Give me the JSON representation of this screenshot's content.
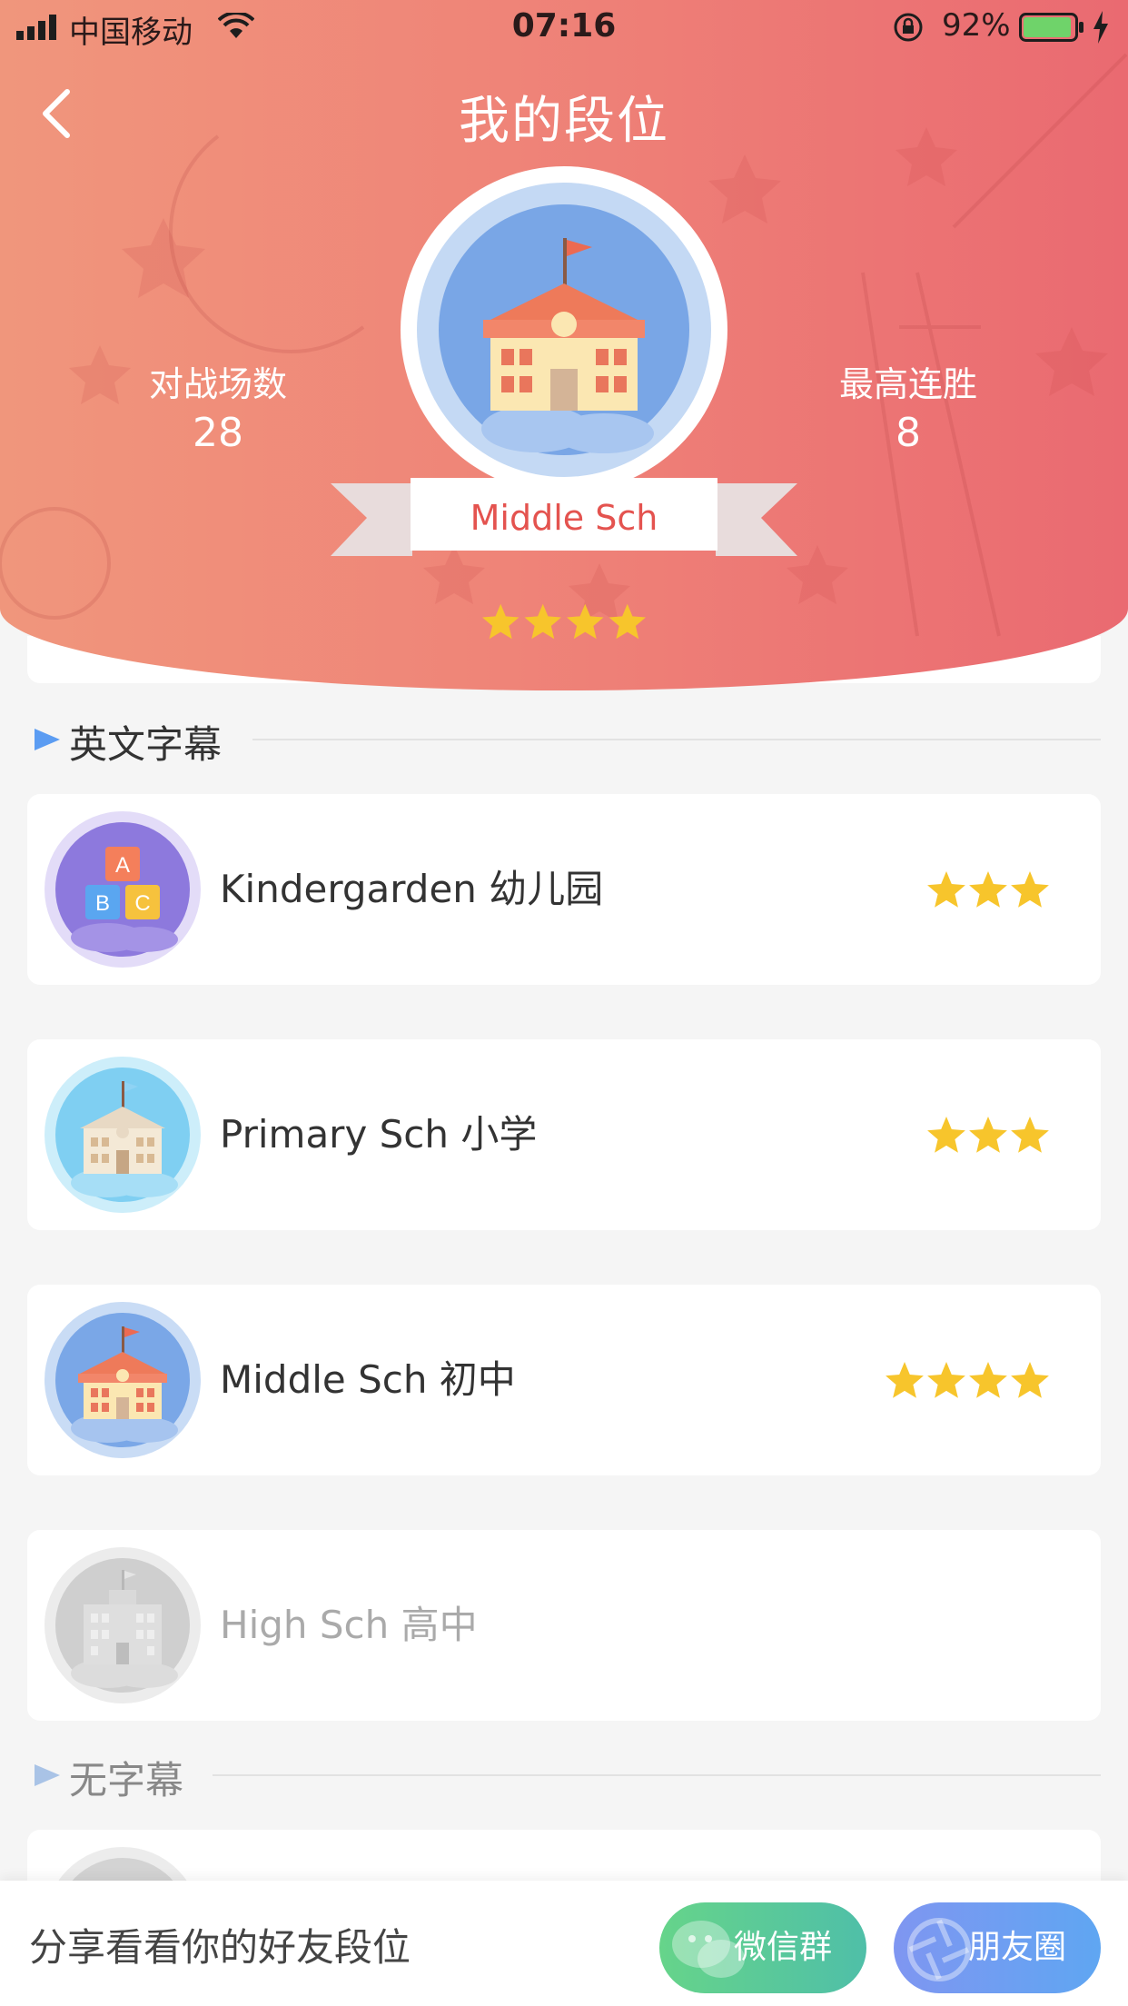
{
  "status_bar": {
    "carrier": "中国移动",
    "time": "07:16",
    "battery_percent": "92%"
  },
  "header": {
    "title": "我的段位",
    "stats": {
      "battles_label": "对战场数",
      "battles_value": "28",
      "streak_label": "最高连胜",
      "streak_value": "8"
    },
    "current_rank": {
      "name": "Middle Sch",
      "stars": 4
    }
  },
  "sections": [
    {
      "title": "英文字幕",
      "levels": [
        {
          "label": "Kindergarden 幼儿园",
          "stars": 3,
          "locked": false,
          "badge": "abc-blocks-icon"
        },
        {
          "label": "Primary Sch 小学",
          "stars": 3,
          "locked": false,
          "badge": "small-school-icon"
        },
        {
          "label": "Middle Sch 初中",
          "stars": 4,
          "locked": false,
          "badge": "school-flag-icon"
        },
        {
          "label": "High Sch 高中",
          "stars": 0,
          "locked": true,
          "badge": "high-school-icon"
        }
      ]
    },
    {
      "title": "无字幕",
      "levels": []
    }
  ],
  "bottom_bar": {
    "share_text": "分享看看你的好友段位",
    "wechat_group_label": "微信群",
    "moments_label": "朋友圈"
  },
  "colors": {
    "header_start": "#f0967c",
    "header_end": "#ea6a71",
    "star": "#f7c52c",
    "rank_text": "#e4534f",
    "wechat_green": "#5cc98e",
    "moments_blue": "#6e9ef2"
  }
}
